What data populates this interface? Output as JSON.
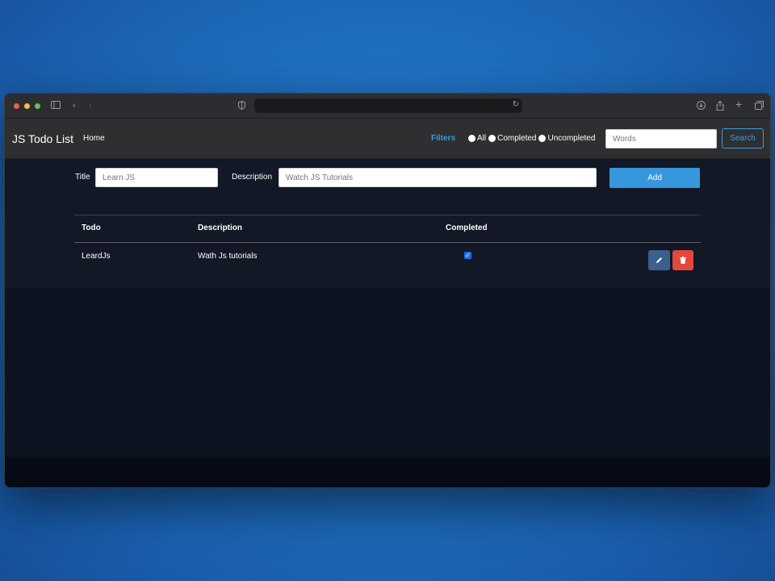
{
  "browser": {
    "traffic_lights": [
      "#ec5f57",
      "#f5bd4f",
      "#5fc454"
    ],
    "url": ""
  },
  "navbar": {
    "brand": "JS Todo List",
    "home": "Home",
    "filters_label": "Filters",
    "filter_options": [
      "All",
      "Completed",
      "Uncompleted"
    ],
    "search_placeholder": "Words",
    "search_button": "Search"
  },
  "form": {
    "title_label": "Title",
    "title_placeholder": "Learn JS",
    "description_label": "Description",
    "description_placeholder": "Watch JS Tutorials",
    "add_button": "Add"
  },
  "table": {
    "headers": [
      "Todo",
      "Description",
      "Completed"
    ],
    "rows": [
      {
        "todo": "LeardJs",
        "description": "Wath Js tutorials",
        "completed": true
      }
    ]
  },
  "colors": {
    "accent": "#3797dd",
    "danger": "#e2483b",
    "edit": "#3c5f8e"
  }
}
